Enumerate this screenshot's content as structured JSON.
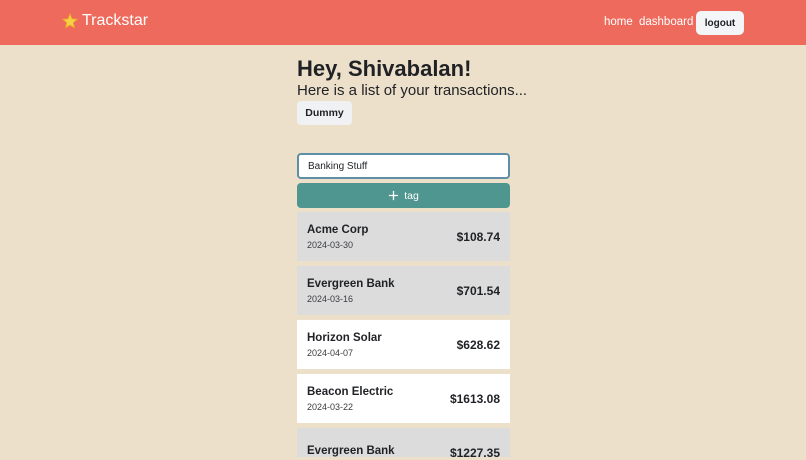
{
  "nav": {
    "brand": "Trackstar",
    "links": [
      "home",
      "dashboard"
    ],
    "logout_label": "logout"
  },
  "header": {
    "greeting": "Hey, Shivabalan!",
    "subtitle": "Here is a list of your transactions...",
    "dummy_label": "Dummy"
  },
  "tag_input": {
    "value": "Banking Stuff"
  },
  "add_tag_label": "tag",
  "transactions": [
    {
      "name": "Acme Corp",
      "date": "2024-03-30",
      "amount": "$108.74",
      "style": "grey"
    },
    {
      "name": "Evergreen Bank",
      "date": "2024-03-16",
      "amount": "$701.54",
      "style": "grey"
    },
    {
      "name": "Horizon Solar",
      "date": "2024-04-07",
      "amount": "$628.62",
      "style": "white"
    },
    {
      "name": "Beacon Electric",
      "date": "2024-03-22",
      "amount": "$1613.08",
      "style": "white"
    },
    {
      "name": "Evergreen Bank",
      "date": "",
      "amount": "$1227.35",
      "style": "grey"
    }
  ],
  "colors": {
    "navbar": "#ee6a5c",
    "background": "#ede0ca",
    "add_tag": "#4f9590",
    "selected_row": "#dcdcdc"
  }
}
